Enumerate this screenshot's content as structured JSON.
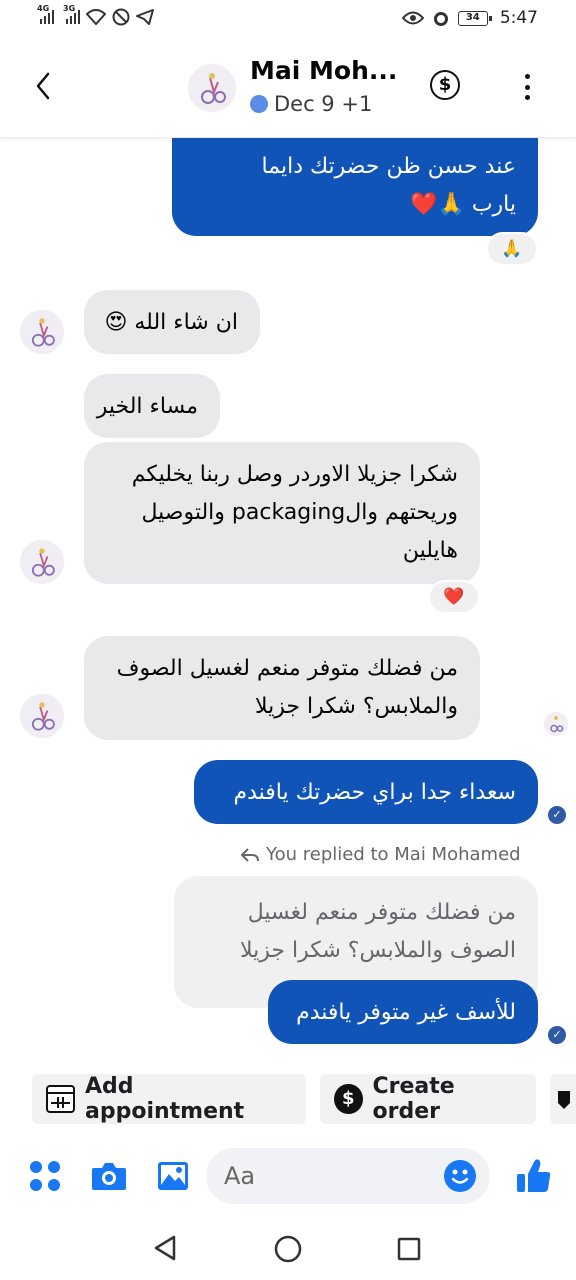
{
  "status_bar": {
    "network_1": "4G",
    "network_2": "3G",
    "battery": "34",
    "time": "5:47"
  },
  "header": {
    "name": "Mai Moh...",
    "subtitle": "Dec 9 +1",
    "back_icon": "chevron-left-icon",
    "payment_icon": "dollar-circle-icon",
    "more_icon": "vertical-dots-icon"
  },
  "messages": [
    {
      "id": "m1",
      "direction": "outgoing",
      "lines": [
        "عند حسن ظن حضرتك دايما",
        "يارب 🙏❤️"
      ],
      "reaction": "🙏"
    },
    {
      "id": "m2",
      "direction": "incoming",
      "lines": [
        "ان شاء الله 😍"
      ]
    },
    {
      "id": "m3",
      "direction": "incoming",
      "lines": [
        "مساء الخير"
      ]
    },
    {
      "id": "m4",
      "direction": "incoming",
      "lines": [
        "شكرا جزيلا الاوردر وصل ربنا يخليكم",
        "وريحتهم والpackaging والتوصيل",
        "هايلين"
      ],
      "reaction": "❤️"
    },
    {
      "id": "m5",
      "direction": "incoming",
      "lines": [
        "من فضلك متوفر منعم لغسيل الصوف",
        "والملابس؟ شكرا جزيلا"
      ]
    },
    {
      "id": "m6",
      "direction": "outgoing",
      "lines": [
        "سعداء جدا براي حضرتك يافندم"
      ]
    },
    {
      "id": "m7",
      "direction": "outgoing",
      "reply_label": "You replied to Mai Mohamed",
      "quoted_lines": [
        "من فضلك متوفر منعم لغسيل",
        "الصوف والملابس؟ شكرا جزيلا"
      ],
      "lines": [
        "للأسف غير متوفر يافندم"
      ]
    }
  ],
  "quick_actions": [
    {
      "label": "Add appointment",
      "icon": "calendar-icon"
    },
    {
      "label": "Create order",
      "icon": "dollar-icon"
    }
  ],
  "composer": {
    "placeholder": "Aa",
    "icons": [
      "menu-dots-icon",
      "camera-icon",
      "gallery-icon",
      "emoji-icon",
      "like-icon"
    ]
  },
  "nav_bar": {
    "icons": [
      "back-triangle-icon",
      "home-circle-icon",
      "recents-square-icon"
    ]
  },
  "colors": {
    "outgoing_bubble": "#1154b8",
    "incoming_bubble": "#e9e9eb",
    "accent": "#1877f2"
  }
}
